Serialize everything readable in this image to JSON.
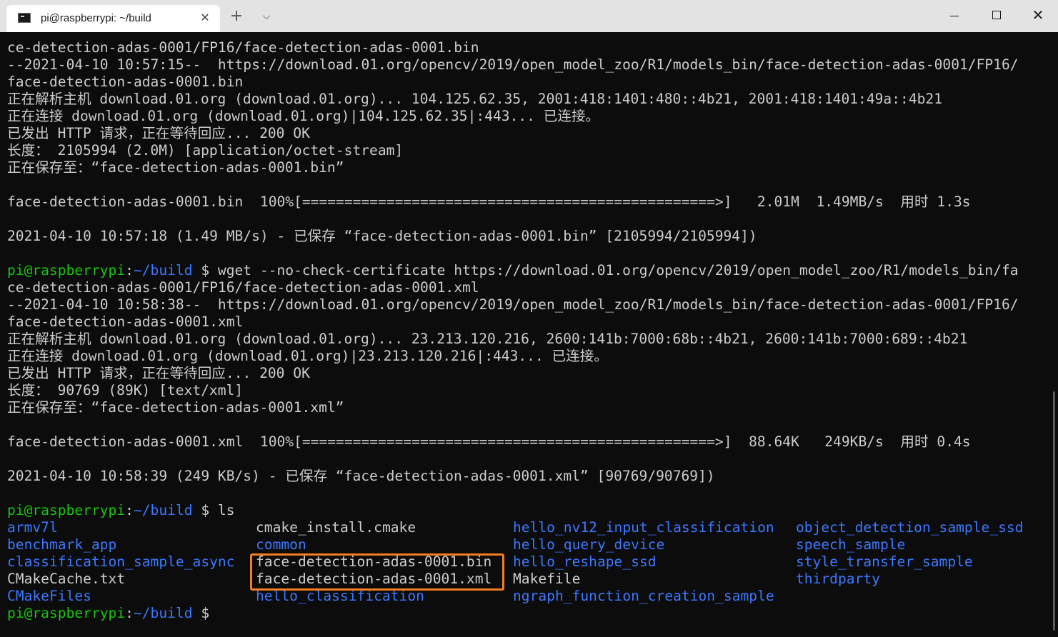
{
  "window": {
    "tab_title": "pi@raspberrypi: ~/build",
    "tab_close": "✕",
    "new_tab": "+",
    "dropdown": "⌵",
    "close": "✕"
  },
  "output_lines": [
    "ce-detection-adas-0001/FP16/face-detection-adas-0001.bin",
    "--2021-04-10 10:57:15--  https://download.01.org/opencv/2019/open_model_zoo/R1/models_bin/face-detection-adas-0001/FP16/",
    "face-detection-adas-0001.bin",
    "正在解析主机 download.01.org (download.01.org)... 104.125.62.35, 2001:418:1401:480::4b21, 2001:418:1401:49a::4b21",
    "正在连接 download.01.org (download.01.org)|104.125.62.35|:443... 已连接。",
    "已发出 HTTP 请求，正在等待回应... 200 OK",
    "长度： 2105994 (2.0M) [application/octet-stream]",
    "正在保存至：“face-detection-adas-0001.bin”",
    "",
    "face-detection-adas-0001.bin  100%[=================================================>]   2.01M  1.49MB/s  用时 1.3s",
    "",
    "2021-04-10 10:57:18 (1.49 MB/s) - 已保存 “face-detection-adas-0001.bin” [2105994/2105994])",
    ""
  ],
  "prompt": {
    "user_host": "pi@raspberrypi",
    "colon": ":",
    "path": "~/build",
    "dollar": " $ "
  },
  "command1": "wget --no-check-certificate https://download.01.org/opencv/2019/open_model_zoo/R1/models_bin/fa",
  "output_lines2": [
    "ce-detection-adas-0001/FP16/face-detection-adas-0001.xml",
    "--2021-04-10 10:58:38--  https://download.01.org/opencv/2019/open_model_zoo/R1/models_bin/face-detection-adas-0001/FP16/",
    "face-detection-adas-0001.xml",
    "正在解析主机 download.01.org (download.01.org)... 23.213.120.216, 2600:141b:7000:68b::4b21, 2600:141b:7000:689::4b21",
    "正在连接 download.01.org (download.01.org)|23.213.120.216|:443... 已连接。",
    "已发出 HTTP 请求，正在等待回应... 200 OK",
    "长度： 90769 (89K) [text/xml]",
    "正在保存至：“face-detection-adas-0001.xml”",
    "",
    "face-detection-adas-0001.xml  100%[=================================================>]  88.64K   249KB/s  用时 0.4s",
    "",
    "2021-04-10 10:58:39 (249 KB/s) - 已保存 “face-detection-adas-0001.xml” [90769/90769])",
    ""
  ],
  "command2": "ls",
  "ls_rows": [
    [
      {
        "text": "armv7l",
        "color": "blue"
      },
      {
        "text": "cmake_install.cmake",
        "color": "white"
      },
      {
        "text": "hello_nv12_input_classification",
        "color": "blue"
      },
      {
        "text": "object_detection_sample_ssd",
        "color": "blue"
      }
    ],
    [
      {
        "text": "benchmark_app",
        "color": "blue"
      },
      {
        "text": "common",
        "color": "blue"
      },
      {
        "text": "hello_query_device",
        "color": "blue"
      },
      {
        "text": "speech_sample",
        "color": "blue"
      }
    ],
    [
      {
        "text": "classification_sample_async",
        "color": "blue"
      },
      {
        "text": "face-detection-adas-0001.bin",
        "color": "white"
      },
      {
        "text": "hello_reshape_ssd",
        "color": "blue"
      },
      {
        "text": "style_transfer_sample",
        "color": "blue"
      }
    ],
    [
      {
        "text": "CMakeCache.txt",
        "color": "white"
      },
      {
        "text": "face-detection-adas-0001.xml",
        "color": "white"
      },
      {
        "text": "Makefile",
        "color": "white"
      },
      {
        "text": "thirdparty",
        "color": "blue"
      }
    ],
    [
      {
        "text": "CMakeFiles",
        "color": "blue"
      },
      {
        "text": "hello_classification",
        "color": "blue"
      },
      {
        "text": "ngraph_function_creation_sample",
        "color": "blue"
      },
      {
        "text": "",
        "color": "white"
      }
    ]
  ],
  "colors": {
    "background": "#0c0c0c",
    "text": "#cccccc",
    "prompt_green": "#16c60c",
    "dir_blue": "#3b78ff",
    "highlight": "#f57c20"
  }
}
